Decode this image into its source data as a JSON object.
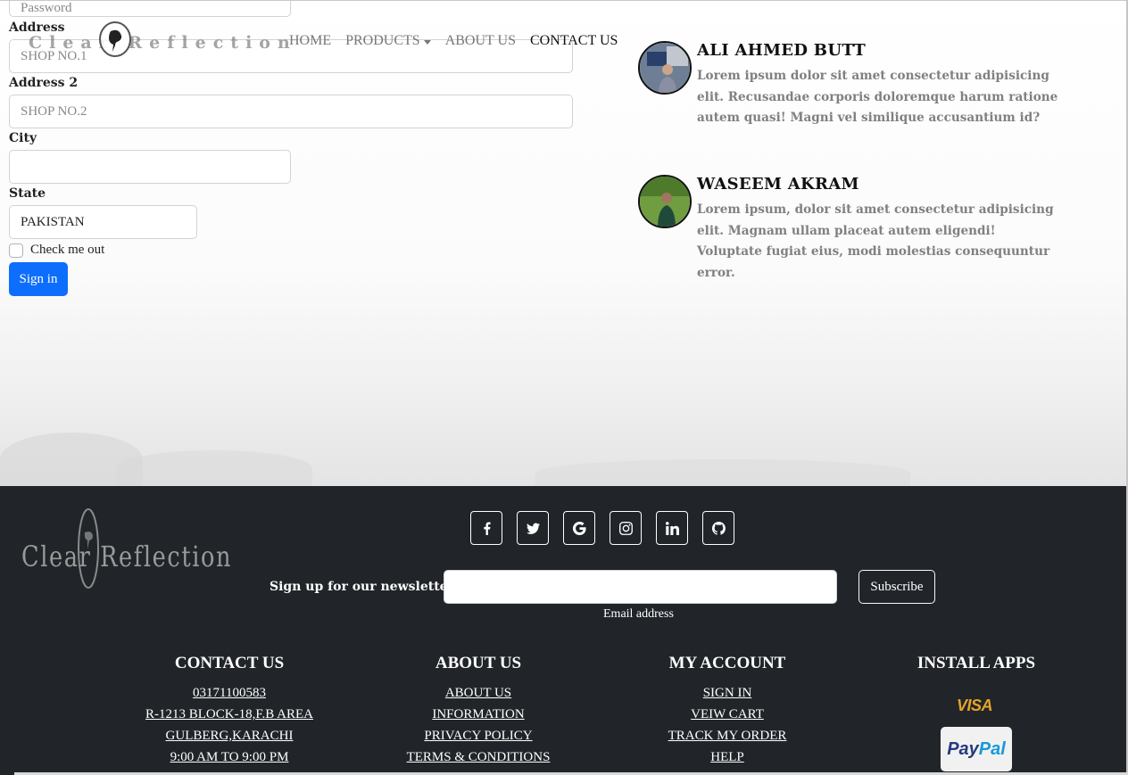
{
  "brand": {
    "logo_text": "Clear Reflection"
  },
  "nav": {
    "items": [
      {
        "label": "HOME"
      },
      {
        "label": "PRODUCTS"
      },
      {
        "label": "ABOUT US"
      },
      {
        "label": "CONTACT US"
      }
    ]
  },
  "form": {
    "password_placeholder": "Password",
    "address_label": "Address",
    "address_value": "SHOP NO.1",
    "address2_label": "Address 2",
    "address2_value": "SHOP NO.2",
    "city_label": "City",
    "city_value": "",
    "state_label": "State",
    "state_value": "PAKISTAN",
    "check_label": "Check me out",
    "submit_label": "Sign in"
  },
  "testimonials": [
    {
      "name": "ALI AHMED BUTT",
      "text": "Lorem ipsum dolor sit amet consectetur adipisicing elit. Recusandae corporis doloremque harum ratione autem quasi! Magni vel similique accusantium id?"
    },
    {
      "name": "WASEEM AKRAM",
      "text": "Lorem ipsum, dolor sit amet consectetur adipisicing elit. Magnam ullam placeat autem eligendi! Voluptate fugiat eius, modi molestias consequuntur error."
    }
  ],
  "footer": {
    "logo_text": "Clear Reflection",
    "socials": [
      "facebook-icon",
      "twitter-icon",
      "google-icon",
      "instagram-icon",
      "linkedin-icon",
      "github-icon"
    ],
    "newsletter": {
      "label": "Sign up for our newsletter",
      "hint": "Email address",
      "button": "Subscribe"
    },
    "columns": [
      {
        "title": "CONTACT US",
        "links": [
          "03171100583",
          "R-1213 BLOCK-18,F.B AREA",
          "GULBERG,KARACHI",
          "9:00 AM TO 9:00 PM"
        ]
      },
      {
        "title": "ABOUT US",
        "links": [
          "ABOUT US",
          "INFORMATION",
          "PRIVACY POLICY",
          "TERMS & CONDITIONS"
        ]
      },
      {
        "title": "MY ACCOUNT",
        "links": [
          "SIGN IN",
          "VEIW CART",
          "TRACK MY ORDER",
          "HELP"
        ]
      },
      {
        "title": "INSTALL APPS",
        "links": []
      }
    ],
    "payments": {
      "visa": "VISA",
      "paypal_a": "Pay",
      "paypal_b": "Pal"
    }
  },
  "colors": {
    "primary": "#0d6efd",
    "footer_bg": "#212529"
  }
}
